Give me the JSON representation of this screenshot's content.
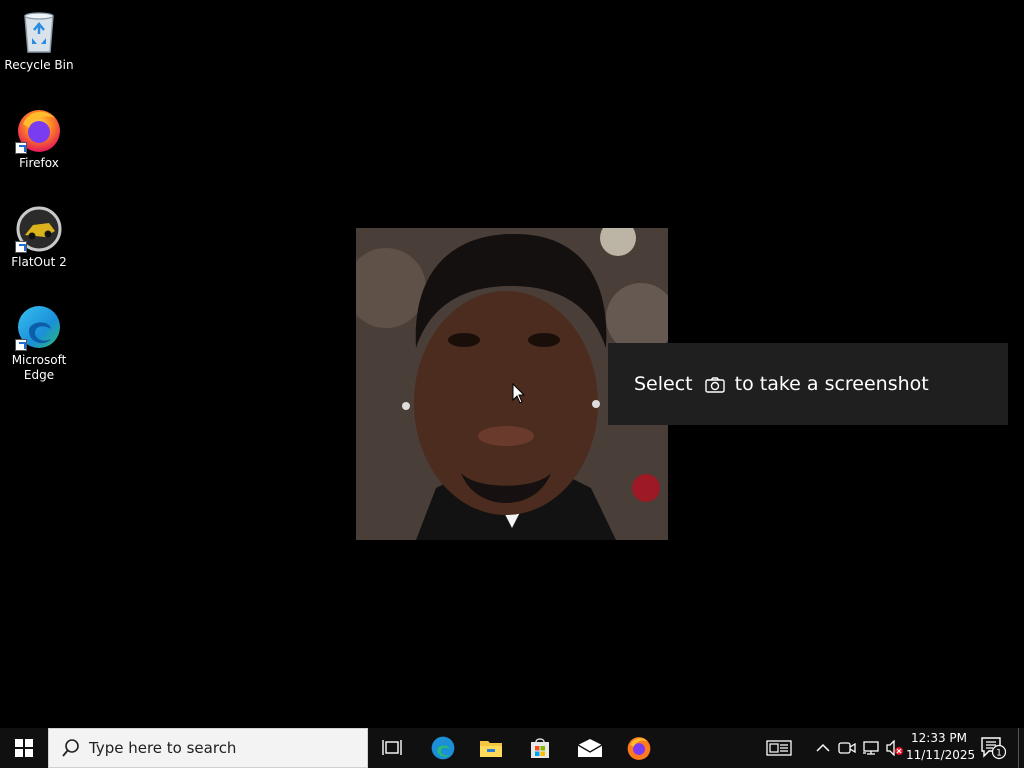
{
  "desktop": {
    "icons": [
      {
        "label": "Recycle Bin",
        "icon": "recycle-bin-icon"
      },
      {
        "label": "Firefox",
        "icon": "firefox-icon"
      },
      {
        "label": "FlatOut 2",
        "icon": "flatout-2-icon"
      },
      {
        "label": "Microsoft Edge",
        "icon": "edge-icon"
      }
    ],
    "hint": {
      "before": "Select",
      "after": "to take a screenshot"
    }
  },
  "taskbar": {
    "search_placeholder": "Type here to search",
    "pinned": [
      {
        "icon": "task-view-icon"
      },
      {
        "icon": "edge-icon"
      },
      {
        "icon": "file-explorer-icon"
      },
      {
        "icon": "store-icon"
      },
      {
        "icon": "mail-icon"
      },
      {
        "icon": "firefox-icon"
      }
    ],
    "tray": [
      {
        "icon": "news-widget-icon"
      },
      {
        "icon": "chevron-up-icon"
      },
      {
        "icon": "meet-now-icon"
      },
      {
        "icon": "network-icon"
      },
      {
        "icon": "volume-muted-icon"
      }
    ],
    "clock": {
      "time": "12:33 PM",
      "date": "11/11/2025"
    },
    "notification_count": "1"
  },
  "colors": {
    "desktop_bg": "#000000",
    "taskbar_bg": "#101010",
    "toast_bg": "#1f1f1f",
    "search_bg": "#f3f3f3"
  }
}
